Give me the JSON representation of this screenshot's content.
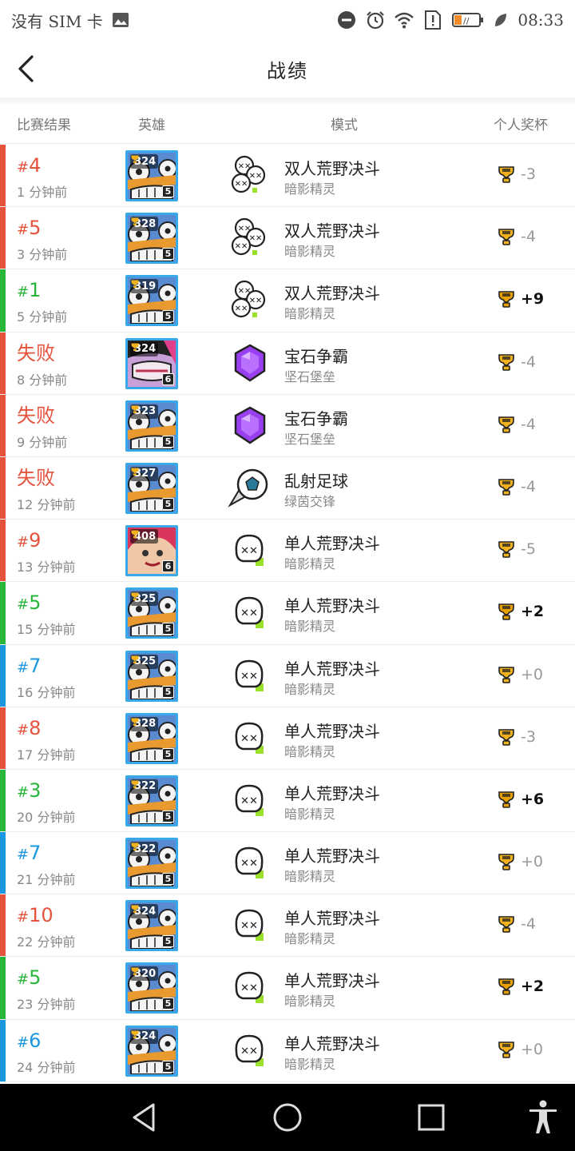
{
  "status_bar": {
    "carrier": "没有 SIM 卡",
    "time": "08:33",
    "icons": [
      "image-icon",
      "do-not-disturb-icon",
      "alarm-icon",
      "wifi-icon",
      "sim-alert-icon",
      "battery-low-icon",
      "leaf-icon"
    ]
  },
  "header": {
    "title": "战绩",
    "back_icon": "chevron-left-icon"
  },
  "columns": {
    "result": "比赛结果",
    "hero": "英雄",
    "mode": "模式",
    "trophy": "个人奖杯"
  },
  "colors": {
    "loss": "#e5533d",
    "win": "#28b53a",
    "neutral": "#1b97e0",
    "hero_border": "#38a8e8"
  },
  "matches": [
    {
      "rank": "4",
      "hash": "#",
      "result": "loss",
      "time": "1 分钟前",
      "hero_trophies": "324",
      "hero_level": "5",
      "hero": "skeleton",
      "mode": "双人荒野决斗",
      "mode_icon": "duo-showdown-icon",
      "map": "暗影精灵",
      "trophy_change": "-3"
    },
    {
      "rank": "5",
      "hash": "#",
      "result": "loss",
      "time": "3 分钟前",
      "hero_trophies": "328",
      "hero_level": "5",
      "hero": "skeleton",
      "mode": "双人荒野决斗",
      "mode_icon": "duo-showdown-icon",
      "map": "暗影精灵",
      "trophy_change": "-4"
    },
    {
      "rank": "1",
      "hash": "#",
      "result": "win",
      "time": "5 分钟前",
      "hero_trophies": "319",
      "hero_level": "5",
      "hero": "skeleton",
      "mode": "双人荒野决斗",
      "mode_icon": "duo-showdown-icon",
      "map": "暗影精灵",
      "trophy_change": "+9"
    },
    {
      "rank": "失败",
      "hash": "",
      "result": "loss",
      "time": "8 分钟前",
      "hero_trophies": "324",
      "hero_level": "6",
      "hero": "pink",
      "mode": "宝石争霸",
      "mode_icon": "gem-grab-icon",
      "map": "坚石堡垒",
      "trophy_change": "-4"
    },
    {
      "rank": "失败",
      "hash": "",
      "result": "loss",
      "time": "9 分钟前",
      "hero_trophies": "323",
      "hero_level": "5",
      "hero": "skeleton",
      "mode": "宝石争霸",
      "mode_icon": "gem-grab-icon",
      "map": "坚石堡垒",
      "trophy_change": "-4"
    },
    {
      "rank": "失败",
      "hash": "",
      "result": "loss",
      "time": "12 分钟前",
      "hero_trophies": "327",
      "hero_level": "5",
      "hero": "skeleton",
      "mode": "乱射足球",
      "mode_icon": "brawl-ball-icon",
      "map": "绿茵交锋",
      "trophy_change": "-4"
    },
    {
      "rank": "9",
      "hash": "#",
      "result": "loss",
      "time": "13 分钟前",
      "hero_trophies": "408",
      "hero_level": "6",
      "hero": "redhair",
      "mode": "单人荒野决斗",
      "mode_icon": "solo-showdown-icon",
      "map": "暗影精灵",
      "trophy_change": "-5"
    },
    {
      "rank": "5",
      "hash": "#",
      "result": "win",
      "time": "15 分钟前",
      "hero_trophies": "325",
      "hero_level": "5",
      "hero": "skeleton",
      "mode": "单人荒野决斗",
      "mode_icon": "solo-showdown-icon",
      "map": "暗影精灵",
      "trophy_change": "+2"
    },
    {
      "rank": "7",
      "hash": "#",
      "result": "neutral",
      "time": "16 分钟前",
      "hero_trophies": "325",
      "hero_level": "5",
      "hero": "skeleton",
      "mode": "单人荒野决斗",
      "mode_icon": "solo-showdown-icon",
      "map": "暗影精灵",
      "trophy_change": "+0"
    },
    {
      "rank": "8",
      "hash": "#",
      "result": "loss",
      "time": "17 分钟前",
      "hero_trophies": "328",
      "hero_level": "5",
      "hero": "skeleton",
      "mode": "单人荒野决斗",
      "mode_icon": "solo-showdown-icon",
      "map": "暗影精灵",
      "trophy_change": "-3"
    },
    {
      "rank": "3",
      "hash": "#",
      "result": "win",
      "time": "20 分钟前",
      "hero_trophies": "322",
      "hero_level": "5",
      "hero": "skeleton",
      "mode": "单人荒野决斗",
      "mode_icon": "solo-showdown-icon",
      "map": "暗影精灵",
      "trophy_change": "+6"
    },
    {
      "rank": "7",
      "hash": "#",
      "result": "neutral",
      "time": "21 分钟前",
      "hero_trophies": "322",
      "hero_level": "5",
      "hero": "skeleton",
      "mode": "单人荒野决斗",
      "mode_icon": "solo-showdown-icon",
      "map": "暗影精灵",
      "trophy_change": "+0"
    },
    {
      "rank": "10",
      "hash": "#",
      "result": "loss",
      "time": "22 分钟前",
      "hero_trophies": "324",
      "hero_level": "5",
      "hero": "skeleton",
      "mode": "单人荒野决斗",
      "mode_icon": "solo-showdown-icon",
      "map": "暗影精灵",
      "trophy_change": "-4"
    },
    {
      "rank": "5",
      "hash": "#",
      "result": "win",
      "time": "23 分钟前",
      "hero_trophies": "320",
      "hero_level": "5",
      "hero": "skeleton",
      "mode": "单人荒野决斗",
      "mode_icon": "solo-showdown-icon",
      "map": "暗影精灵",
      "trophy_change": "+2"
    },
    {
      "rank": "6",
      "hash": "#",
      "result": "neutral",
      "time": "24 分钟前",
      "hero_trophies": "324",
      "hero_level": "5",
      "hero": "skeleton",
      "mode": "单人荒野决斗",
      "mode_icon": "solo-showdown-icon",
      "map": "暗影精灵",
      "trophy_change": "+0"
    }
  ],
  "nav_bar": {
    "buttons": [
      "back-triangle-icon",
      "home-circle-icon",
      "recents-square-icon",
      "accessibility-icon"
    ]
  }
}
